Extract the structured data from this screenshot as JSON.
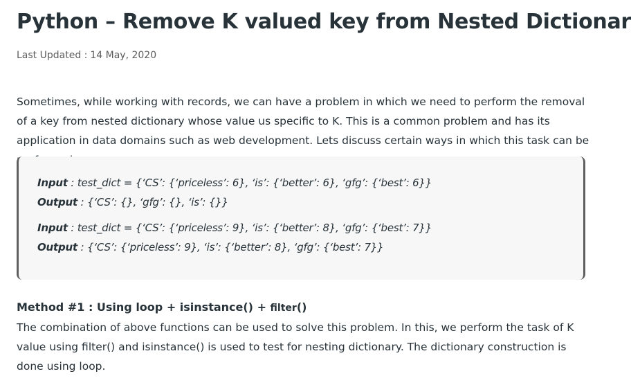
{
  "article": {
    "title": "Python – Remove K valued key from Nested Dictionary",
    "last_updated_label": "Last Updated :",
    "last_updated_date": "14 May, 2020",
    "intro": "Sometimes, while working with records, we can have a problem in which we need to perform the removal of a key from nested dictionary whose value us specific to K. This is a common problem and has its application in data domains such as web development. Lets discuss certain ways in which this task can be performed."
  },
  "example": {
    "input_label": "Input",
    "output_label": "Output",
    "input_1": " : test_dict = {‘CS’: {‘priceless’: 6}, ‘is’: {‘better’: 6}, ‘gfg’: {‘best’: 6}}",
    "output_1": " : {‘CS’: {}, ‘gfg’: {}, ‘is’: {}}",
    "input_2": " : test_dict = {‘CS’: {‘priceless’: 9}, ‘is’: {‘better’: 8}, ‘gfg’: {‘best’: 7}}",
    "output_2": " : {‘CS’: {‘priceless’: 9}, ‘is’: {‘better’: 8}, ‘gfg’: {‘best’: 7}}"
  },
  "method": {
    "heading_main": "Method #1 : Using loop + isinstance() + ",
    "heading_small": "filter",
    "heading_end": "()",
    "description": "The combination of above functions can be used to solve this problem. In this, we perform the task of K value using filter() and isinstance() is used to test for nesting dictionary. The dictionary construction is done using loop."
  }
}
